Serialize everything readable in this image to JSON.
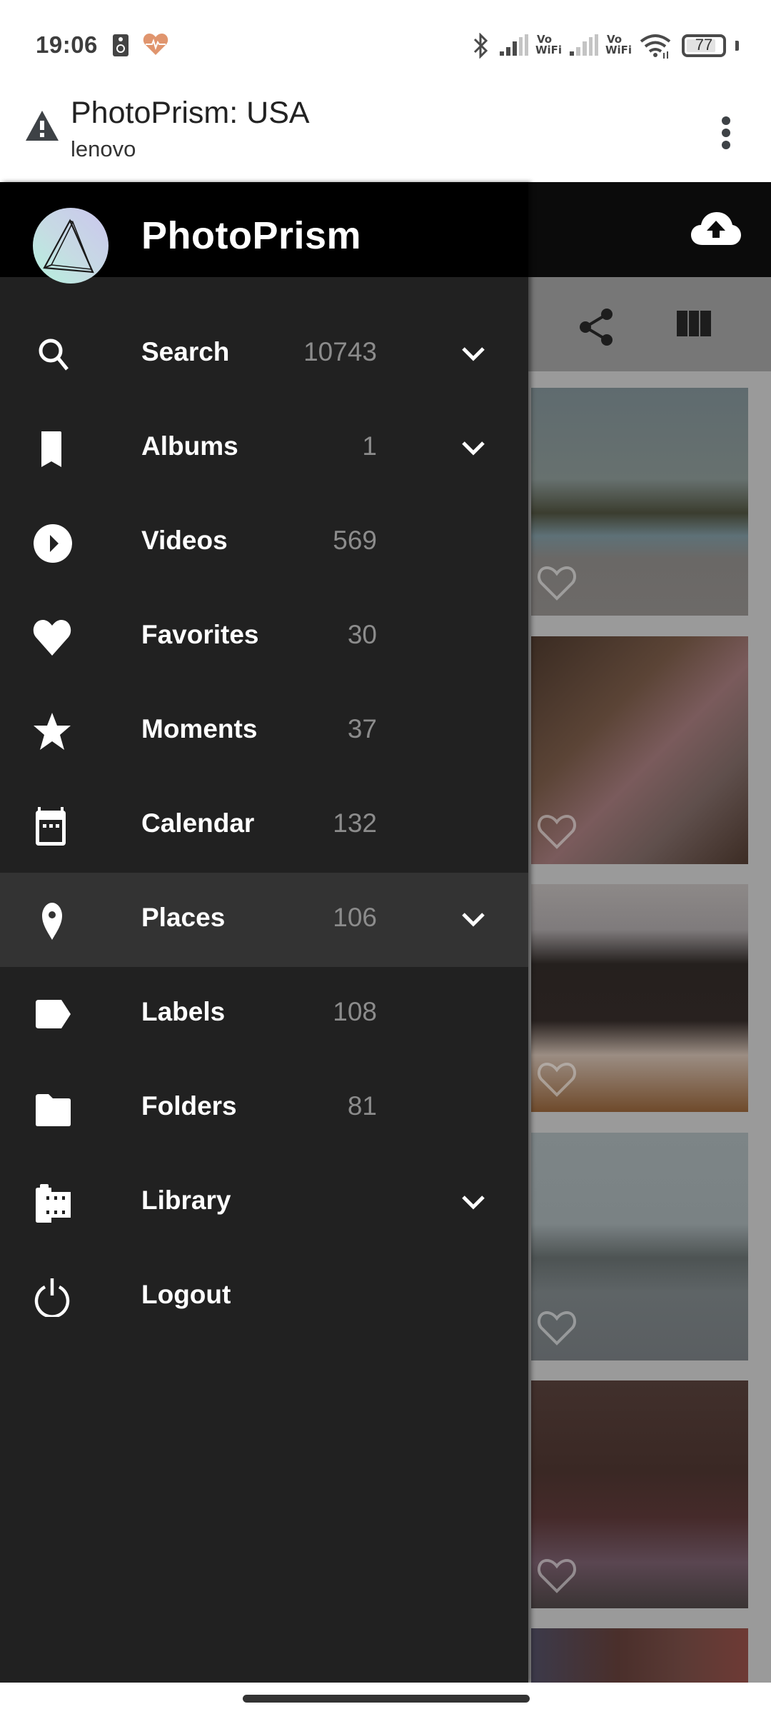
{
  "status_bar": {
    "time": "19:06",
    "left_icons": [
      "speaker-icon",
      "health-heart-icon"
    ],
    "right_icons": [
      "bluetooth-icon",
      "signal-icon",
      "vowifi-icon",
      "signal-icon",
      "vowifi-icon",
      "wifi-icon",
      "battery-icon"
    ],
    "vowifi_top": "Vo",
    "vowifi_bottom": "WiFi",
    "battery_level": "77",
    "battery_fraction": 0.77
  },
  "browser": {
    "title": "PhotoPrism: USA",
    "subtitle": "lenovo",
    "security_icon": "warning-icon",
    "menu_icon": "more-vert-icon"
  },
  "app": {
    "header_actions": [
      "cloud-upload-icon"
    ],
    "toolbar_actions": [
      "share-icon",
      "view-column-icon"
    ],
    "photos": [
      {
        "name": "reflecting-pool",
        "favorite": false
      },
      {
        "name": "temple-group",
        "favorite": false
      },
      {
        "name": "train-interior",
        "favorite": false
      },
      {
        "name": "un-plaza",
        "favorite": false
      },
      {
        "name": "man-sweater",
        "favorite": false
      },
      {
        "name": "group-partial",
        "favorite": false
      }
    ]
  },
  "drawer": {
    "title": "PhotoPrism",
    "logo": "photoprism-logo",
    "items": [
      {
        "label": "Search",
        "count": "10743",
        "icon": "search-icon",
        "expandable": true,
        "active": false
      },
      {
        "label": "Albums",
        "count": "1",
        "icon": "bookmark-icon",
        "expandable": true,
        "active": false
      },
      {
        "label": "Videos",
        "count": "569",
        "icon": "play-circle-icon",
        "expandable": false,
        "active": false
      },
      {
        "label": "Favorites",
        "count": "30",
        "icon": "heart-icon",
        "expandable": false,
        "active": false
      },
      {
        "label": "Moments",
        "count": "37",
        "icon": "star-icon",
        "expandable": false,
        "active": false
      },
      {
        "label": "Calendar",
        "count": "132",
        "icon": "calendar-icon",
        "expandable": false,
        "active": false
      },
      {
        "label": "Places",
        "count": "106",
        "icon": "place-icon",
        "expandable": true,
        "active": true
      },
      {
        "label": "Labels",
        "count": "108",
        "icon": "label-icon",
        "expandable": false,
        "active": false
      },
      {
        "label": "Folders",
        "count": "81",
        "icon": "folder-icon",
        "expandable": false,
        "active": false
      },
      {
        "label": "Library",
        "count": "",
        "icon": "film-icon",
        "expandable": true,
        "active": false
      },
      {
        "label": "Logout",
        "count": "",
        "icon": "power-icon",
        "expandable": false,
        "active": false
      }
    ]
  },
  "colors": {
    "drawer_bg": "#212121",
    "drawer_active_bg": "#333333",
    "header_bg": "#000000",
    "count_text": "#8c8c8c",
    "health_icon": "#e0956e"
  }
}
